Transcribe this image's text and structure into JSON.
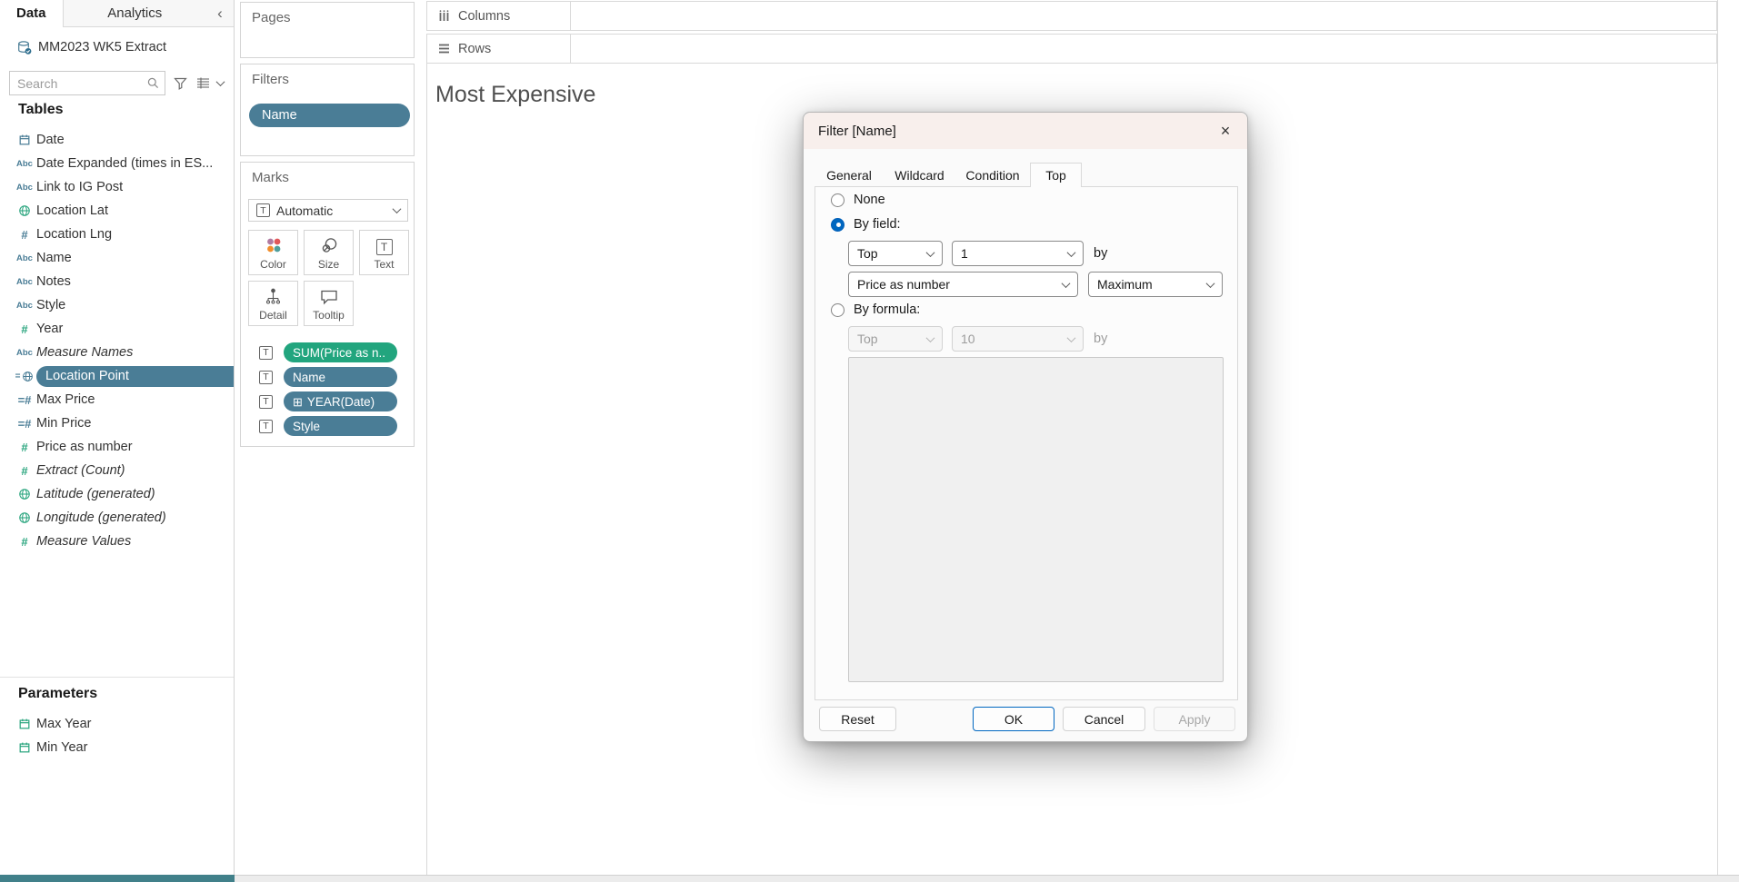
{
  "icons": {
    "abc": "Abc",
    "hash": "#",
    "hash_eq": "=#",
    "eq": "=",
    "text_mark": "T",
    "close": "×",
    "collapse": "‹",
    "plus_box": "⊞"
  },
  "colors": {
    "accent": "#0067c0",
    "pill_blue": "#4a7d96",
    "pill_green": "#22a57e",
    "icon_green": "#2aa57e",
    "titlebar": "#f8efec",
    "bottom_teal": "#41808a"
  },
  "data_pane": {
    "tab_data": "Data",
    "tab_analytics": "Analytics",
    "datasource": "MM2023 WK5 Extract",
    "search_placeholder": "Search",
    "tables_header": "Tables",
    "fields": [
      {
        "label": "Date"
      },
      {
        "label": "Date Expanded (times in ES..."
      },
      {
        "label": "Link to IG Post"
      },
      {
        "label": "Location Lat"
      },
      {
        "label": "Location Lng"
      },
      {
        "label": "Name"
      },
      {
        "label": "Notes"
      },
      {
        "label": "Style"
      },
      {
        "label": "Year"
      },
      {
        "label": "Measure Names"
      },
      {
        "label": "Location Point"
      },
      {
        "label": "Max Price"
      },
      {
        "label": "Min Price"
      },
      {
        "label": "Price as number"
      },
      {
        "label": "Extract (Count)"
      },
      {
        "label": "Latitude (generated)"
      },
      {
        "label": "Longitude (generated)"
      },
      {
        "label": "Measure Values"
      }
    ],
    "parameters_header": "Parameters",
    "parameters": [
      {
        "label": "Max Year"
      },
      {
        "label": "Min Year"
      }
    ]
  },
  "cards": {
    "pages_title": "Pages",
    "filters_title": "Filters",
    "filter_pill": "Name",
    "marks_title": "Marks",
    "mark_type": "Automatic",
    "mark_buttons": {
      "color": "Color",
      "size": "Size",
      "text": "Text",
      "detail": "Detail",
      "tooltip": "Tooltip"
    },
    "pills": [
      {
        "label": "SUM(Price as n.."
      },
      {
        "label": "Name"
      },
      {
        "label": "YEAR(Date)"
      },
      {
        "label": "Style"
      }
    ]
  },
  "shelves": {
    "columns": "Columns",
    "rows": "Rows"
  },
  "sheet": {
    "title": "Most Expensive"
  },
  "dialog": {
    "title": "Filter [Name]",
    "tabs": [
      "General",
      "Wildcard",
      "Condition",
      "Top"
    ],
    "active_tab": "Top",
    "none_label": "None",
    "by_field_label": "By field:",
    "by_formula_label": "By formula:",
    "by_field": {
      "direction": "Top",
      "count": "1",
      "by_label": "by",
      "field": "Price as number",
      "aggregation": "Maximum"
    },
    "by_formula": {
      "direction": "Top",
      "count": "10",
      "by_label": "by"
    },
    "buttons": {
      "reset": "Reset",
      "ok": "OK",
      "cancel": "Cancel",
      "apply": "Apply"
    }
  }
}
